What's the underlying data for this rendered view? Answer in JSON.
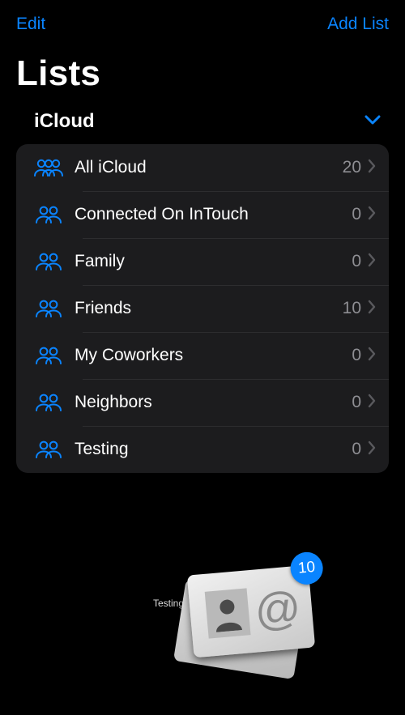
{
  "nav": {
    "edit": "Edit",
    "addList": "Add List"
  },
  "title": "Lists",
  "section": {
    "label": "iCloud",
    "expanded": true
  },
  "lists": [
    {
      "icon": "group3",
      "label": "All iCloud",
      "count": "20"
    },
    {
      "icon": "group2",
      "label": "Connected On InTouch",
      "count": "0"
    },
    {
      "icon": "group2",
      "label": "Family",
      "count": "0"
    },
    {
      "icon": "group2",
      "label": "Friends",
      "count": "10"
    },
    {
      "icon": "group2",
      "label": "My Coworkers",
      "count": "0"
    },
    {
      "icon": "group2",
      "label": "Neighbors",
      "count": "0"
    },
    {
      "icon": "group2",
      "label": "Testing",
      "count": "0"
    }
  ],
  "drag": {
    "label": "Testing",
    "badge": "10"
  },
  "colors": {
    "accent": "#0a84ff",
    "rowBg": "#1c1c1e",
    "secondaryText": "#8e8e93"
  }
}
